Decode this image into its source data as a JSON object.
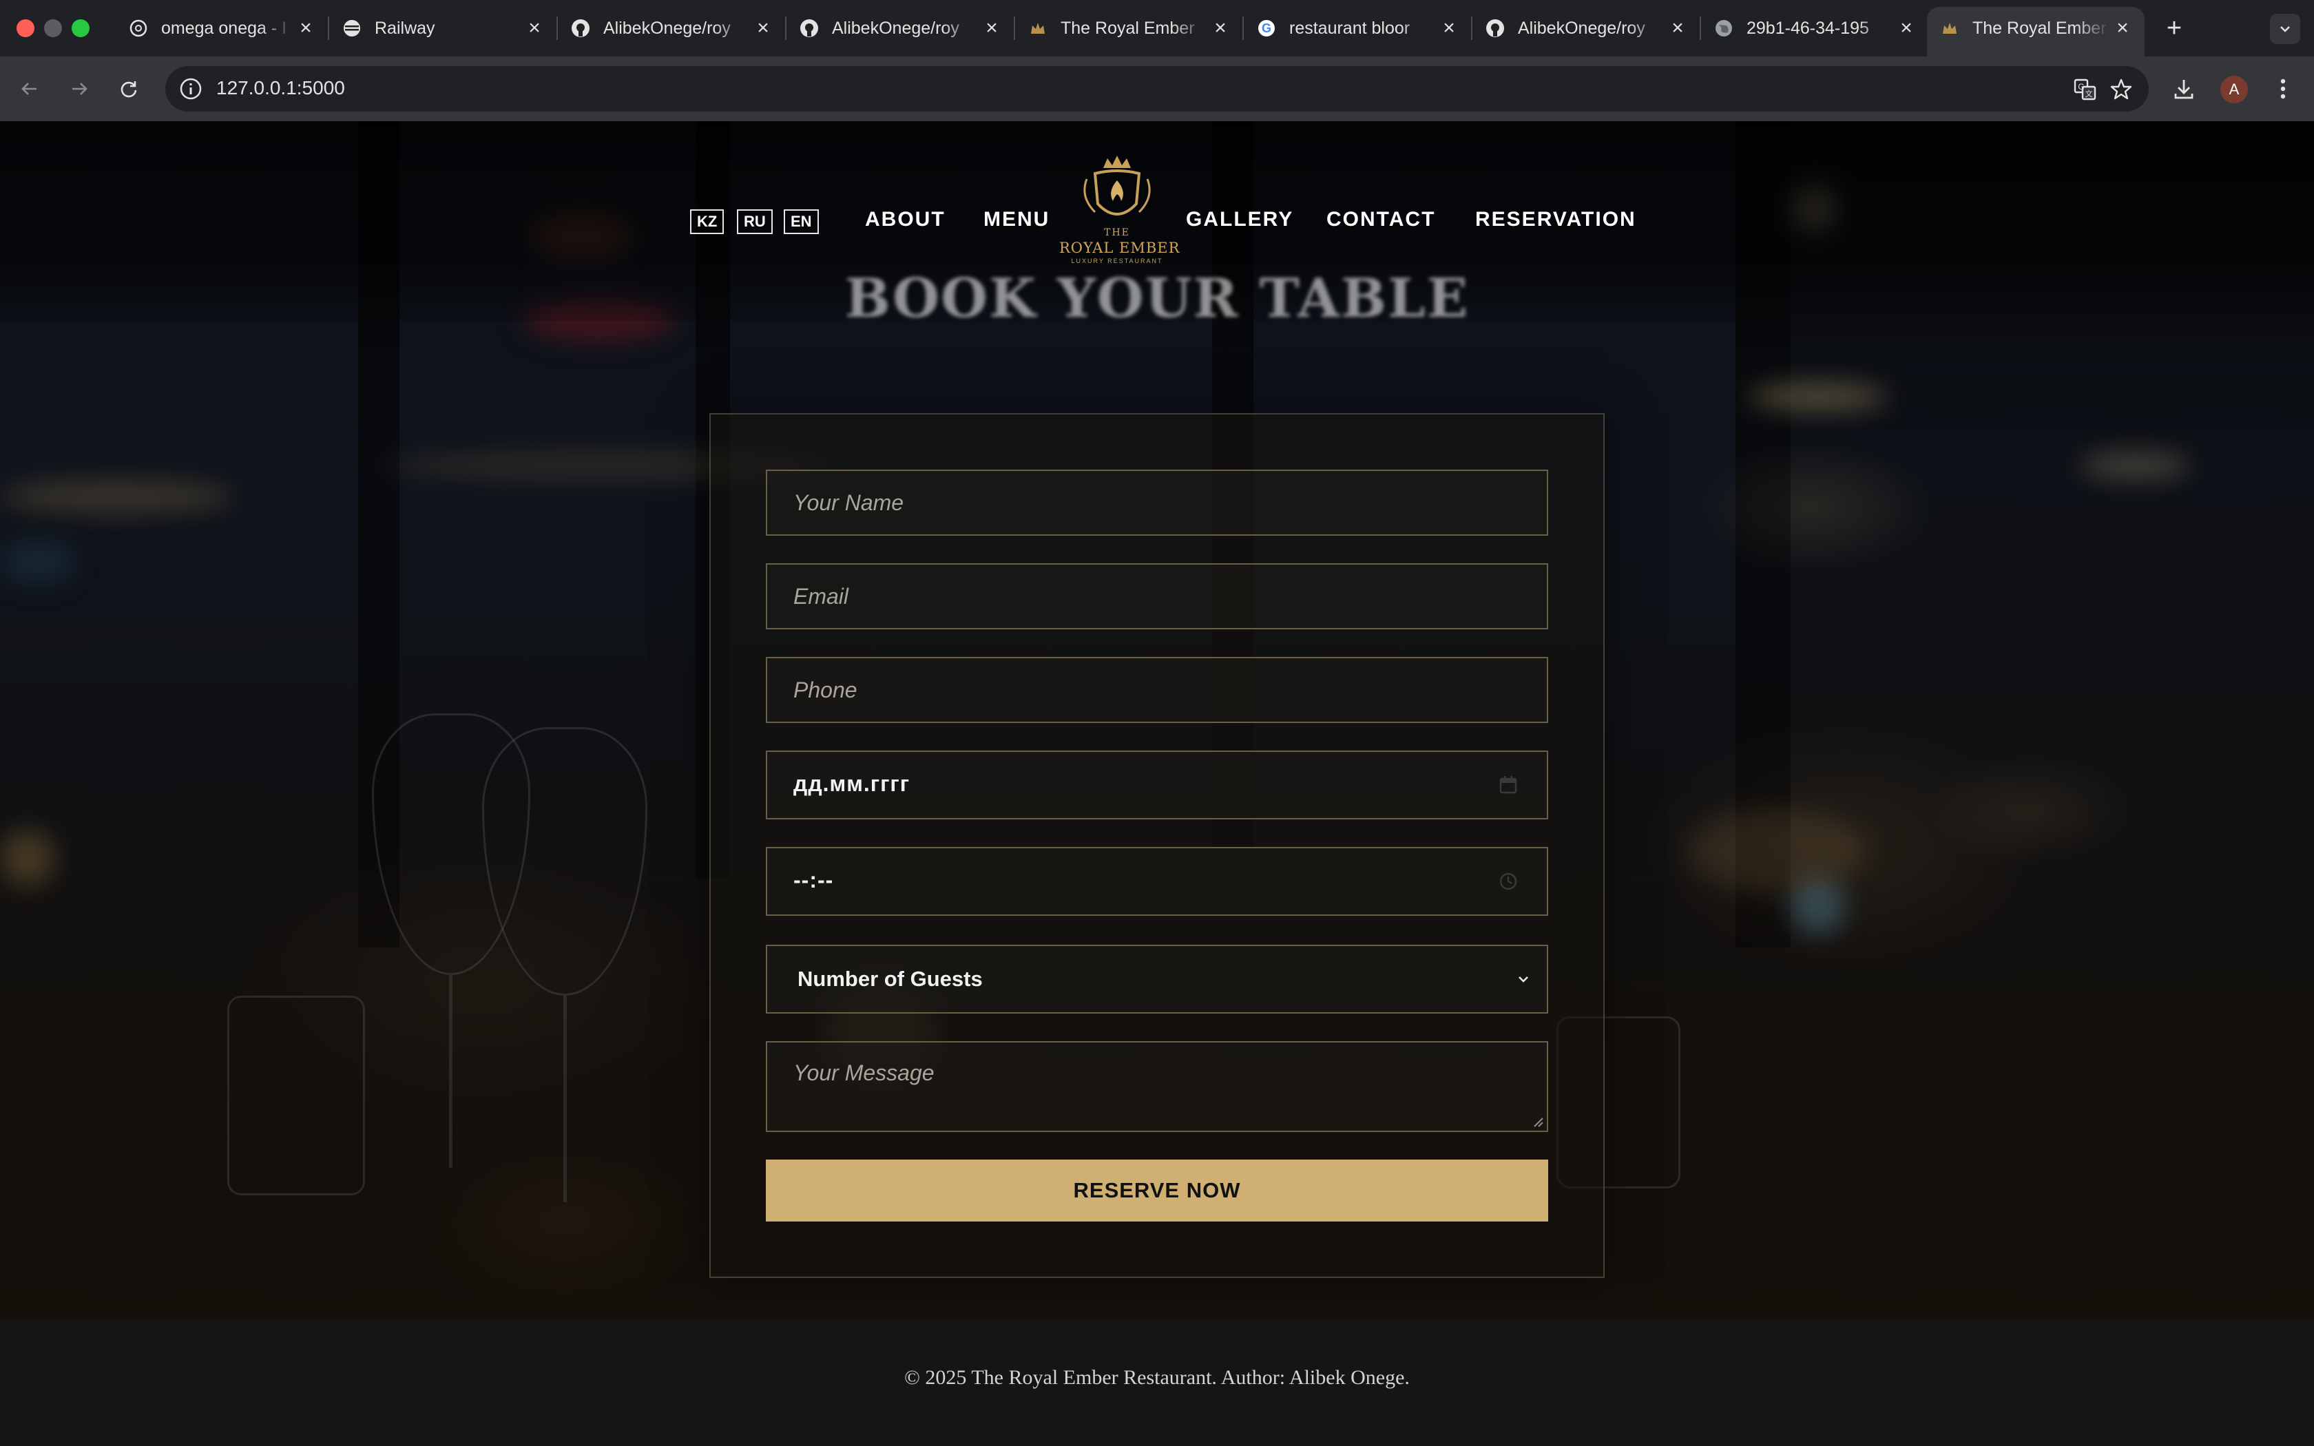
{
  "browser": {
    "tabs": [
      {
        "title": "omega onega - I",
        "favicon": "openai-icon"
      },
      {
        "title": "Railway",
        "favicon": "railway-icon"
      },
      {
        "title": "AlibekOnege/roy",
        "favicon": "github-icon"
      },
      {
        "title": "AlibekOnege/roy",
        "favicon": "github-icon"
      },
      {
        "title": "The Royal Ember",
        "favicon": "crown-icon"
      },
      {
        "title": "restaurant bloor",
        "favicon": "google-icon"
      },
      {
        "title": "AlibekOnege/roy",
        "favicon": "github-icon"
      },
      {
        "title": "29b1-46-34-195",
        "favicon": "globe-icon"
      },
      {
        "title": "The Royal Ember",
        "favicon": "crown-icon",
        "active": true
      }
    ],
    "url": "127.0.0.1:5000",
    "profile_initial": "A"
  },
  "site": {
    "languages": [
      "KZ",
      "RU",
      "EN"
    ],
    "nav_left": [
      "ABOUT",
      "MENU"
    ],
    "nav_right": [
      "GALLERY",
      "CONTACT",
      "RESERVATION"
    ],
    "logo": {
      "top": "THE",
      "name": "ROYAL EMBER",
      "sub": "LUXURY RESTAURANT"
    },
    "section_title": "BOOK YOUR TABLE"
  },
  "form": {
    "name_placeholder": "Your Name",
    "email_placeholder": "Email",
    "phone_placeholder": "Phone",
    "date_value": "дд.мм.гггг",
    "time_value": "--:--",
    "guests_selected": "Number of Guests",
    "message_placeholder": "Your Message",
    "submit_label": "RESERVE NOW"
  },
  "footer": {
    "text": "© 2025 The Royal Ember Restaurant. Author: Alibek Onege."
  },
  "colors": {
    "accent_gold": "#cfaf72",
    "field_border": "#6b5f47",
    "chrome_bg": "#202124",
    "toolbar_bg": "#35363a"
  }
}
